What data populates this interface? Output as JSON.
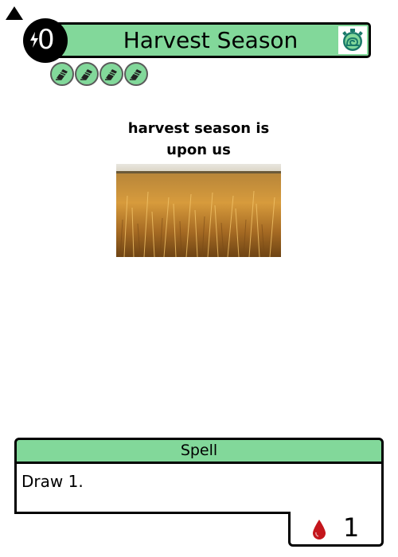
{
  "card": {
    "title": "Harvest Season",
    "cost": "0",
    "cost_icon": "energy-bolt-icon",
    "timer_icon": "stopwatch-snail-icon",
    "tag_icons": [
      "keyword-tag-icon",
      "keyword-tag-icon",
      "keyword-tag-icon",
      "keyword-tag-icon"
    ],
    "art_caption": "harvest season is upon us",
    "type_line": "Spell",
    "rules_text": "Draw 1.",
    "blood_cost": "1",
    "blood_icon": "blood-drop-icon"
  },
  "colors": {
    "accent": "#82d89a",
    "blood": "#c4161c",
    "timer": "#1a7a6a"
  }
}
